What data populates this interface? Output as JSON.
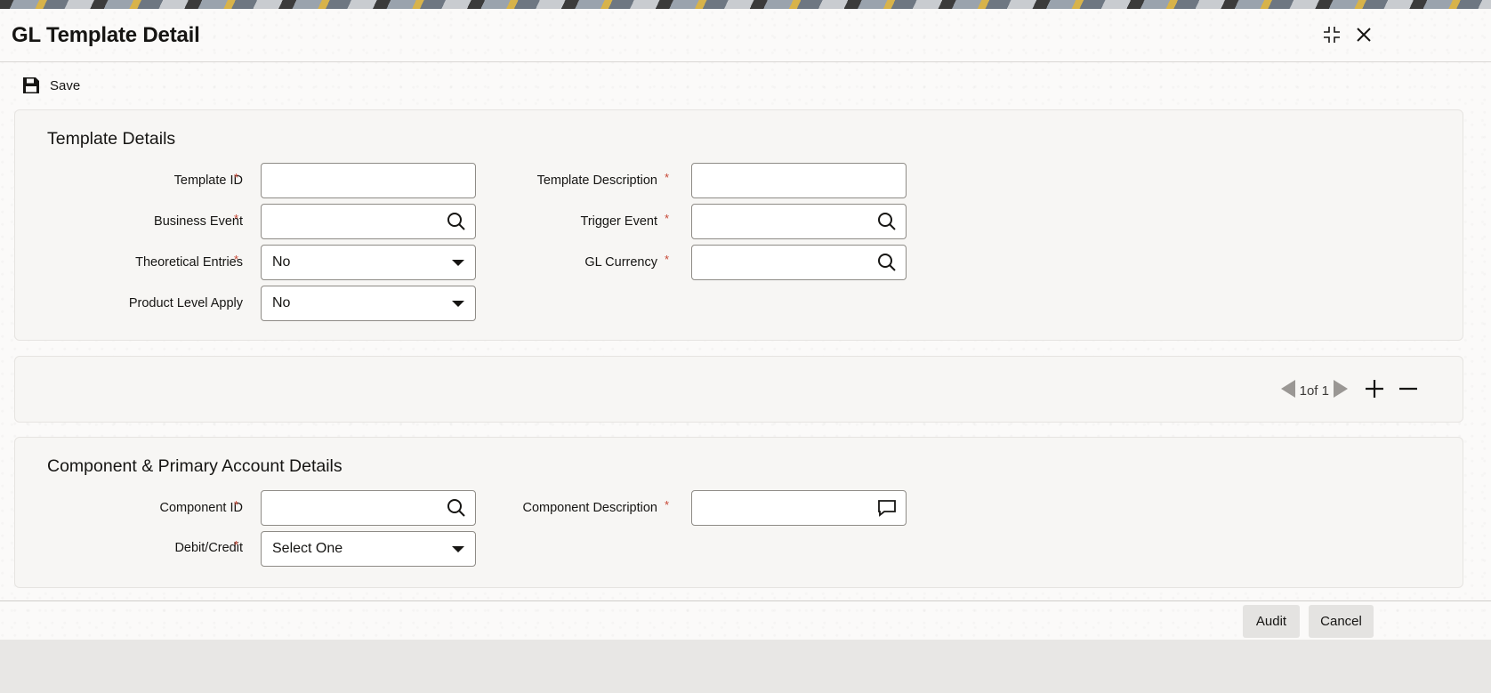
{
  "window": {
    "title": "GL Template Detail",
    "maximize_icon": "maximize-icon",
    "close_icon": "close-icon"
  },
  "toolbar": {
    "save_label": "Save",
    "save_icon": "floppy-disk-icon"
  },
  "template_details": {
    "section_title": "Template Details",
    "template_id": {
      "label": "Template ID",
      "required": "*",
      "value": ""
    },
    "business_event": {
      "label": "Business Event",
      "required": "*",
      "value": ""
    },
    "theoretical_entries": {
      "label": "Theoretical Entries",
      "required": "*",
      "value": "No"
    },
    "product_level_apply": {
      "label": "Product Level Apply",
      "value": "No"
    },
    "template_description": {
      "label": "Template Description",
      "required": "*",
      "value": ""
    },
    "trigger_event": {
      "label": "Trigger Event",
      "required": "*",
      "value": ""
    },
    "gl_currency": {
      "label": "GL Currency",
      "required": "*",
      "value": ""
    }
  },
  "pager": {
    "text": "1of 1",
    "prev_icon": "triangle-left-icon",
    "next_icon": "triangle-right-icon",
    "add_icon": "plus-icon",
    "remove_icon": "minus-icon"
  },
  "component_details": {
    "section_title": "Component & Primary Account Details",
    "component_id": {
      "label": "Component ID",
      "required": "*",
      "value": ""
    },
    "debit_credit": {
      "label": "Debit/Credit",
      "required": "*",
      "value": "Select One"
    },
    "component_description": {
      "label": "Component Description",
      "required": "*",
      "value": ""
    }
  },
  "footer": {
    "audit_label": "Audit",
    "cancel_label": "Cancel"
  },
  "colors": {
    "required": "#c74634",
    "panel": "#f7f6f4",
    "text": "#161513",
    "button": "#e4e3e1"
  }
}
